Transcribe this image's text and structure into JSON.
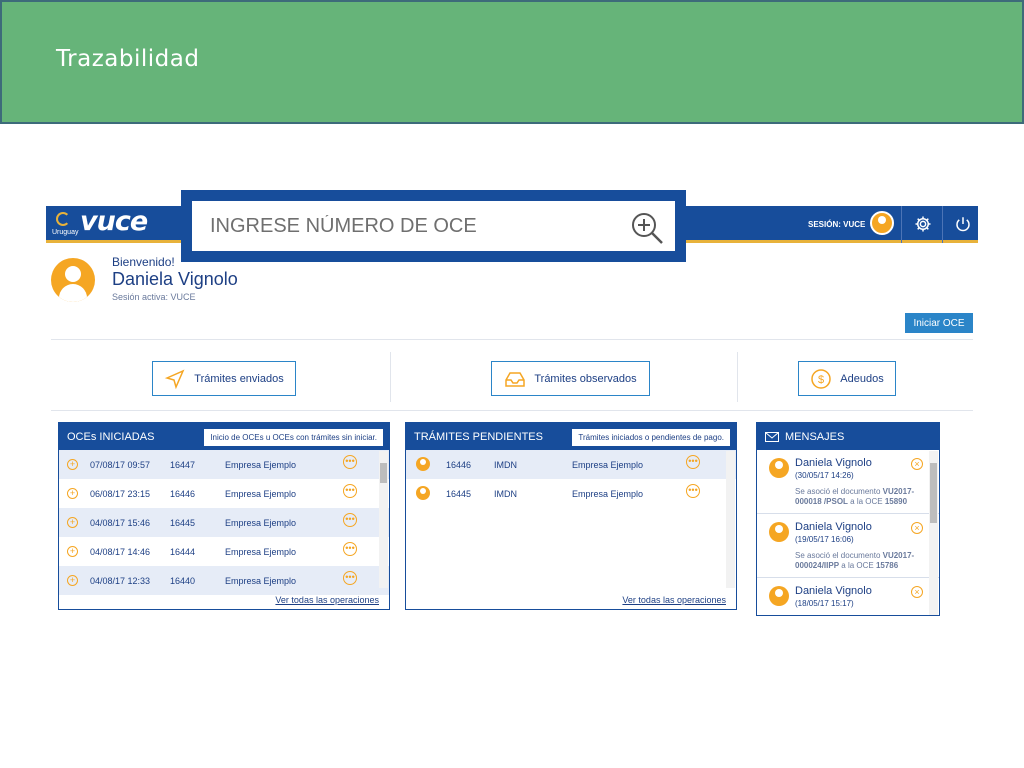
{
  "banner": {
    "title": "Trazabilidad"
  },
  "app": {
    "logo_text": "vuce",
    "logo_sub": "Uruguay",
    "session_label": "SESIÓN: VUCE",
    "icons": [
      "avatar-icon",
      "gear-icon",
      "power-icon"
    ]
  },
  "search": {
    "placeholder": "INGRESE NÚMERO DE OCE"
  },
  "welcome": {
    "greeting": "Bienvenido!",
    "name": "Daniela Vignolo",
    "session": "Sesión activa: VUCE"
  },
  "actions": {
    "start_oce": "Iniciar OCE",
    "sent": "Trámites enviados",
    "observed": "Trámites observados",
    "debts": "Adeudos"
  },
  "oces": {
    "title": "OCEs INICIADAS",
    "hint": "Inicio de OCEs u OCEs con trámites sin iniciar.",
    "link": "Ver todas las operaciones",
    "rows": [
      {
        "date": "07/08/17 09:57",
        "id": "16447",
        "company": "Empresa Ejemplo"
      },
      {
        "date": "06/08/17 23:15",
        "id": "16446",
        "company": "Empresa Ejemplo"
      },
      {
        "date": "04/08/17 15:46",
        "id": "16445",
        "company": "Empresa Ejemplo"
      },
      {
        "date": "04/08/17 14:46",
        "id": "16444",
        "company": "Empresa Ejemplo"
      },
      {
        "date": "04/08/17 12:33",
        "id": "16440",
        "company": "Empresa Ejemplo"
      }
    ]
  },
  "pending": {
    "title": "TRÁMITES PENDIENTES",
    "hint": "Trámites iniciados o pendientes de pago.",
    "link": "Ver todas las operaciones",
    "rows": [
      {
        "id": "16446",
        "type": "IMDN",
        "company": "Empresa Ejemplo"
      },
      {
        "id": "16445",
        "type": "IMDN",
        "company": "Empresa Ejemplo"
      }
    ]
  },
  "messages": {
    "title": "MENSAJES",
    "items": [
      {
        "name": "Daniela Vignolo",
        "date": "(30/05/17 14:26)",
        "text_pre": "Se asoció el documento ",
        "doc": "VU2017-000018 /PSOL",
        "text_mid": " a la OCE ",
        "oce": "15890"
      },
      {
        "name": "Daniela Vignolo",
        "date": "(19/05/17 16:06)",
        "text_pre": "Se asoció el documento ",
        "doc": "VU2017-000024/IIPP",
        "text_mid": " a la OCE ",
        "oce": "15786"
      },
      {
        "name": "Daniela Vignolo",
        "date": "(18/05/17 15:17)",
        "text_pre": "",
        "doc": "",
        "text_mid": "",
        "oce": ""
      }
    ]
  },
  "colors": {
    "brand_blue": "#174d9b",
    "accent_orange": "#f5a623",
    "banner_green": "#66b479",
    "button_blue": "#2b85c8"
  }
}
